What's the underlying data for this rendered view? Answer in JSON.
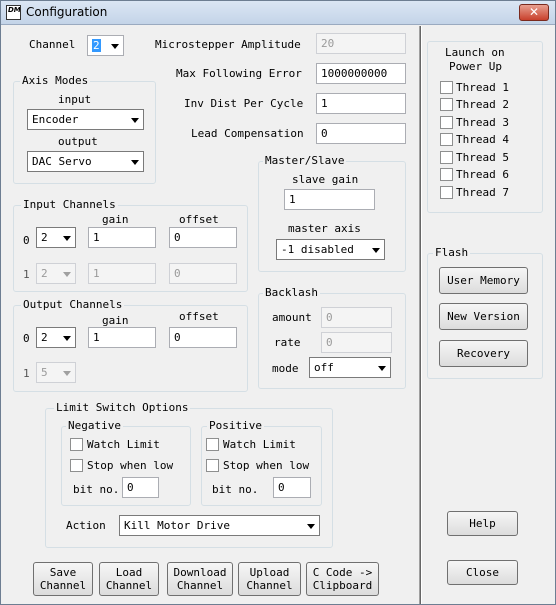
{
  "window": {
    "title": "Configuration",
    "icon_text": "DM"
  },
  "channel": {
    "label": "Channel",
    "value": "2"
  },
  "microstepper": {
    "label": "Microstepper Amplitude",
    "value": "20"
  },
  "max_following_error": {
    "label": "Max Following Error",
    "value": "1000000000"
  },
  "inv_dist_per_cycle": {
    "label": "Inv Dist Per Cycle",
    "value": "1"
  },
  "lead_compensation": {
    "label": "Lead Compensation",
    "value": "0"
  },
  "axis_modes": {
    "title": "Axis Modes",
    "input_label": "input",
    "input_value": "Encoder",
    "output_label": "output",
    "output_value": "DAC Servo"
  },
  "master_slave": {
    "title": "Master/Slave",
    "slave_gain_label": "slave gain",
    "slave_gain_value": "1",
    "master_axis_label": "master axis",
    "master_axis_value": "-1 disabled"
  },
  "input_channels": {
    "title": "Input Channels",
    "gain_label": "gain",
    "offset_label": "offset",
    "rows": [
      {
        "index": "0",
        "channel": "2",
        "gain": "1",
        "offset": "0"
      },
      {
        "index": "1",
        "channel": "2",
        "gain": "1",
        "offset": "0"
      }
    ]
  },
  "output_channels": {
    "title": "Output Channels",
    "gain_label": "gain",
    "offset_label": "offset",
    "rows": [
      {
        "index": "0",
        "channel": "2",
        "gain": "1",
        "offset": "0"
      },
      {
        "index": "1",
        "channel": "5"
      }
    ]
  },
  "backlash": {
    "title": "Backlash",
    "amount_label": "amount",
    "amount_value": "0",
    "rate_label": "rate",
    "rate_value": "0",
    "mode_label": "mode",
    "mode_value": "off"
  },
  "limit_switch": {
    "title": "Limit Switch Options",
    "negative": {
      "title": "Negative",
      "watch_label": "Watch Limit",
      "stop_label": "Stop when low",
      "bit_label": "bit no.",
      "bit_value": "0"
    },
    "positive": {
      "title": "Positive",
      "watch_label": "Watch Limit",
      "stop_label": "Stop when low",
      "bit_label": "bit no.",
      "bit_value": "0"
    },
    "action_label": "Action",
    "action_value": "Kill Motor Drive"
  },
  "bottom_buttons": {
    "save": [
      "Save",
      "Channel"
    ],
    "load": [
      "Load",
      "Channel"
    ],
    "download": [
      "Download",
      "Channel"
    ],
    "upload": [
      "Upload",
      "Channel"
    ],
    "ccode": [
      "C Code ->",
      "Clipboard"
    ]
  },
  "launch": {
    "title_line1": "Launch on",
    "title_line2": "Power Up",
    "threads": [
      "Thread 1",
      "Thread 2",
      "Thread 3",
      "Thread 4",
      "Thread 5",
      "Thread 6",
      "Thread 7"
    ]
  },
  "flash": {
    "title": "Flash",
    "user_memory": "User Memory",
    "new_version": "New Version",
    "recovery": "Recovery"
  },
  "help_label": "Help",
  "close_label": "Close"
}
